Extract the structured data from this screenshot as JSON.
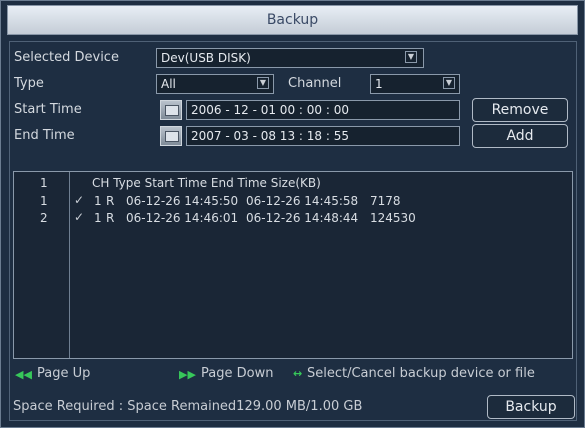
{
  "window": {
    "title": "Backup"
  },
  "form": {
    "selected_device_label": "Selected Device",
    "selected_device_value": "Dev(USB DISK)",
    "type_label": "Type",
    "type_value": "All",
    "channel_label": "Channel",
    "channel_value": "1",
    "start_time_label": "Start Time",
    "start_time_value": "2006 - 12 - 01   00 : 00 : 00",
    "end_time_label": "End Time",
    "end_time_value": "2007 - 03 - 08   13 : 18 : 55"
  },
  "buttons": {
    "remove": "Remove",
    "add": "Add",
    "backup": "Backup"
  },
  "list": {
    "header_index": "1",
    "header_cols": "CH Type   Start Time          End Time     Size(KB)",
    "rows": [
      {
        "index": "1",
        "checked": true,
        "ch": "1",
        "type": "R",
        "start": "06-12-26 14:45:50",
        "end": "06-12-26 14:45:58",
        "size": "7178"
      },
      {
        "index": "2",
        "checked": true,
        "ch": "1",
        "type": "R",
        "start": "06-12-26 14:46:01",
        "end": "06-12-26 14:48:44",
        "size": "124530"
      }
    ]
  },
  "hints": {
    "page_up": "Page Up",
    "page_down": "Page Down",
    "select_cancel": "Select/Cancel backup device or file"
  },
  "status": {
    "space_text": "Space Required : Space Remained129.00 MB/1.00 GB"
  }
}
